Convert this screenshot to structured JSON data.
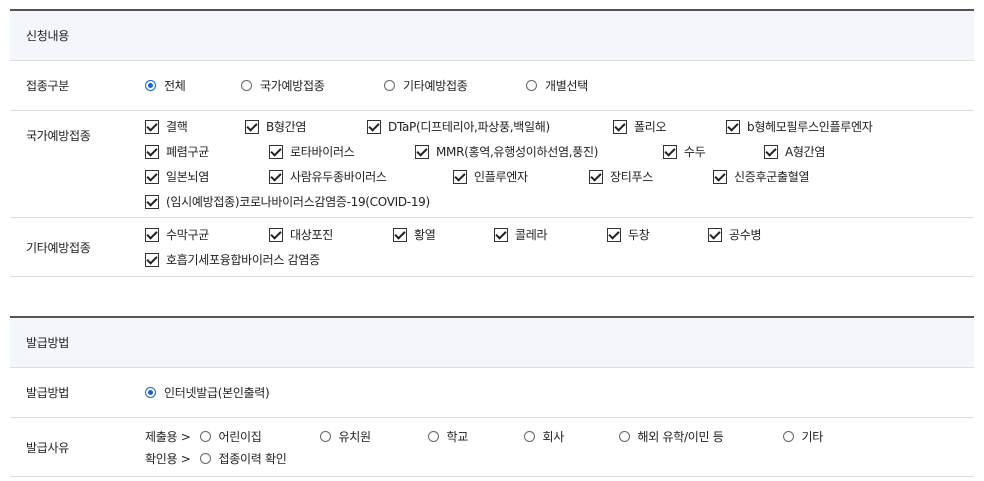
{
  "apply": {
    "title": "신청내용",
    "type_label": "접종구분",
    "type_options": [
      "전체",
      "국가예방접종",
      "기타예방접종",
      "개별선택"
    ],
    "type_selected": 0,
    "national_label": "국가예방접종",
    "national_rows": [
      [
        "결핵",
        "B형간염",
        "DTaP(디프테리아,파상풍,백일해)",
        "폴리오",
        "b형헤모필루스인플루엔자"
      ],
      [
        "폐렴구균",
        "로타바이러스",
        "MMR(홍역,유행성이하선염,풍진)",
        "수두",
        "A형간염"
      ],
      [
        "일본뇌염",
        "사람유두종바이러스",
        "인플루엔자",
        "장티푸스",
        "신증후군출혈열"
      ],
      [
        "(임시예방접종)코로나바이러스감염증-19(COVID-19)"
      ]
    ],
    "other_label": "기타예방접종",
    "other_rows": [
      [
        "수막구균",
        "대상포진",
        "황열",
        "콜레라",
        "두창",
        "공수병"
      ],
      [
        "호흡기세포융합바이러스 감염증"
      ]
    ]
  },
  "issue": {
    "title": "발급방법",
    "method_label": "발급방법",
    "method_option": "인터넷발급(본인출력)",
    "reason_label": "발급사유",
    "submit_prefix": "제출용 >",
    "submit_options": [
      "어린이집",
      "유치원",
      "학교",
      "회사",
      "해외 유학/이민 등",
      "기타"
    ],
    "confirm_prefix": "확인용 >",
    "confirm_options": [
      "접종이력 확인"
    ]
  }
}
